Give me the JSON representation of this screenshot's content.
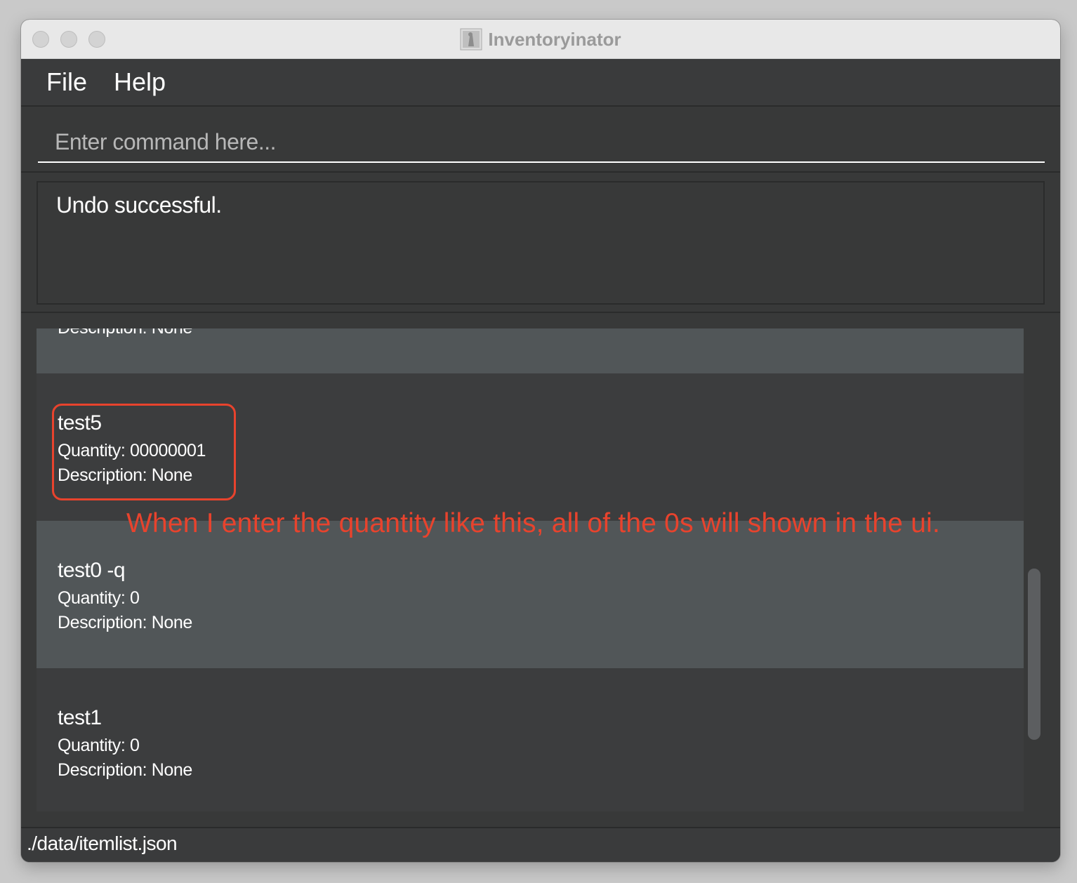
{
  "window": {
    "title": "Inventoryinator"
  },
  "menu": {
    "items": [
      {
        "label": "File"
      },
      {
        "label": "Help"
      }
    ]
  },
  "command": {
    "placeholder": "Enter command here...",
    "value": ""
  },
  "result": {
    "text": "Undo successful."
  },
  "items": [
    {
      "name": "",
      "quantity_label": "",
      "description_label": "Description: None"
    },
    {
      "name": "test5",
      "quantity_label": "Quantity: 00000001",
      "description_label": "Description: None"
    },
    {
      "name": "test0 -q",
      "quantity_label": "Quantity: 0",
      "description_label": "Description: None"
    },
    {
      "name": "test1",
      "quantity_label": "Quantity: 0",
      "description_label": "Description: None"
    }
  ],
  "annotation": {
    "text": "When I enter the quantity like this, all of the 0s will shown in the ui.",
    "color": "#e8432d"
  },
  "status": {
    "file_path": "./data/itemlist.json"
  },
  "icons": [
    "close-dot",
    "minimize-dot",
    "zoom-dot",
    "app-icon"
  ],
  "colors": {
    "background": "#383939",
    "card_alt": "#515658",
    "annotation": "#e8432d"
  }
}
